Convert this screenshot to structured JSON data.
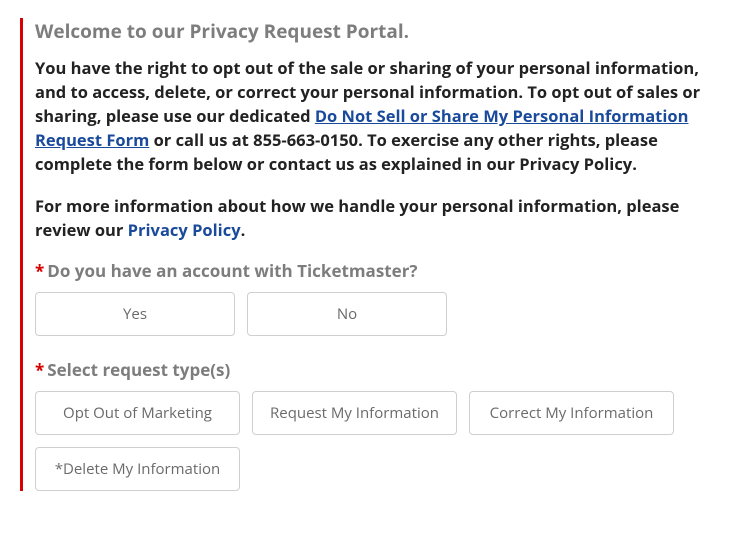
{
  "heading": "Welcome to our Privacy Request Portal.",
  "intro": {
    "part1": "You have the right to opt out of the sale or sharing of your personal information, and to access, delete, or correct your personal information. To opt out of sales or sharing, please use our dedicated ",
    "link1_text": "Do Not Sell or Share My Personal Information Request Form",
    "part2": " or call us at 855-663-0150. To exercise any other rights, please complete the form below or contact us as explained in our Privacy Policy."
  },
  "more_info": {
    "part1": "For more information about how we handle your personal information, please review our ",
    "link_text": "Privacy Policy",
    "part2": "."
  },
  "q1": {
    "asterisk": "*",
    "label": "Do you have an account with Ticketmaster?",
    "yes": "Yes",
    "no": "No"
  },
  "q2": {
    "asterisk": "*",
    "label": "Select request type(s)",
    "opt1": "Opt Out of Marketing",
    "opt2": "Request My Information",
    "opt3": "Correct My Information",
    "opt4": "*Delete My Information"
  }
}
